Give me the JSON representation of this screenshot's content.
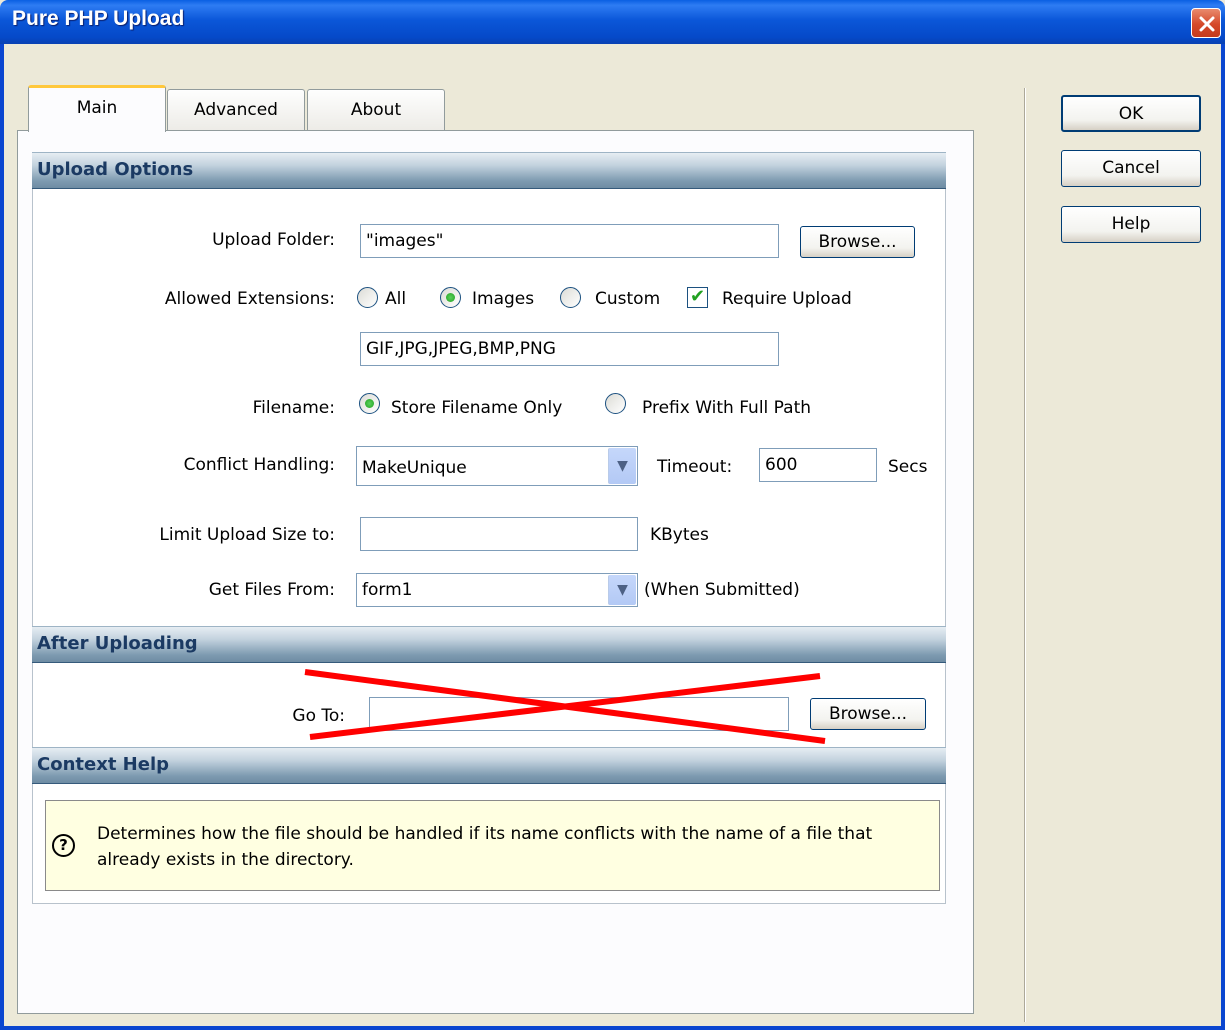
{
  "window": {
    "title": "Pure PHP Upload"
  },
  "tabs": [
    {
      "label": "Main",
      "active": true
    },
    {
      "label": "Advanced",
      "active": false
    },
    {
      "label": "About",
      "active": false
    }
  ],
  "sections": {
    "upload_options": "Upload Options",
    "after_uploading": "After Uploading",
    "context_help": "Context Help"
  },
  "upload_folder": {
    "label": "Upload Folder:",
    "value": "\"images\"",
    "browse": "Browse..."
  },
  "allowed_extensions": {
    "label": "Allowed Extensions:",
    "options": [
      "All",
      "Images",
      "Custom"
    ],
    "selected": "Images",
    "require_upload_label": "Require Upload",
    "require_upload_checked": true,
    "list_value": "GIF,JPG,JPEG,BMP,PNG"
  },
  "filename": {
    "label": "Filename:",
    "options": [
      "Store Filename Only",
      "Prefix With Full Path"
    ],
    "selected": "Store Filename Only"
  },
  "conflict": {
    "label": "Conflict Handling:",
    "value": "MakeUnique",
    "timeout_label": "Timeout:",
    "timeout_value": "600",
    "timeout_unit": "Secs"
  },
  "limit_size": {
    "label": "Limit Upload Size to:",
    "value": "",
    "unit": "KBytes"
  },
  "get_files": {
    "label": "Get Files From:",
    "value": "form1",
    "note": "(When Submitted)"
  },
  "goto": {
    "label": "Go To:",
    "value": "",
    "browse": "Browse..."
  },
  "context_help_text": "Determines how the file should be handled if its name conflicts with the name of a file that already exists in the directory.",
  "buttons": {
    "ok": "OK",
    "cancel": "Cancel",
    "help": "Help"
  },
  "annotation": {
    "cross_color": "#ff0000"
  },
  "icons": [
    "close-icon",
    "dropdown-arrow-icon",
    "help-question-icon",
    "checkmark-icon"
  ]
}
